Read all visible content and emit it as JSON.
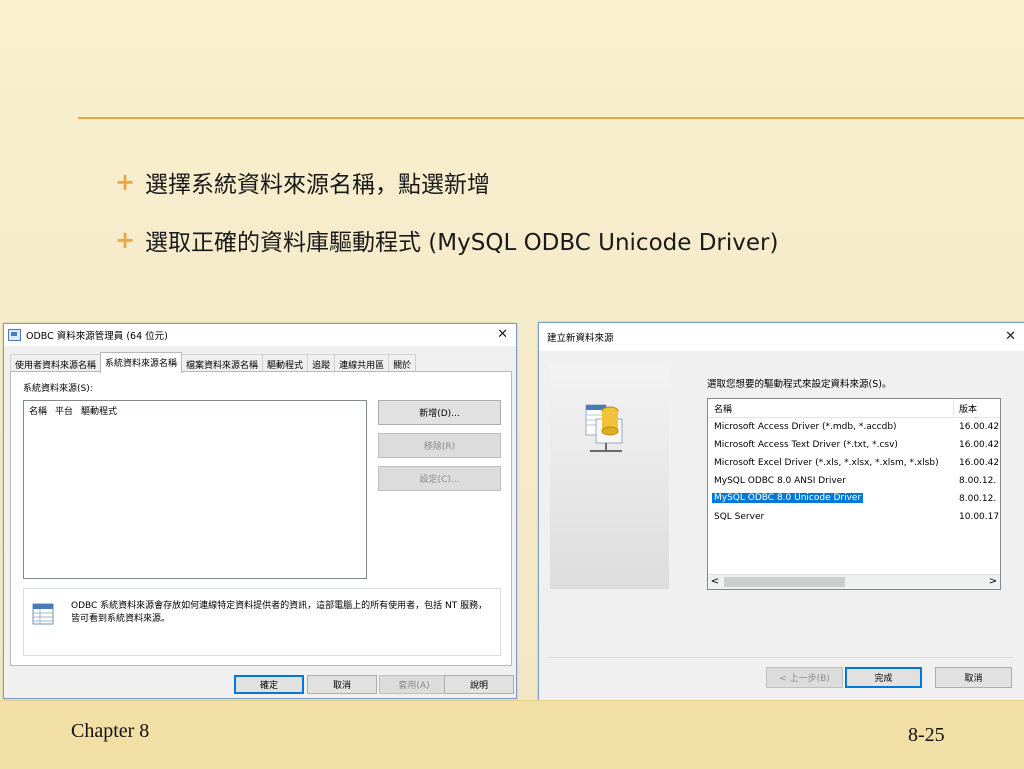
{
  "slide": {
    "bullets": [
      "選擇系統資料來源名稱，點選新增",
      "選取正確的資料庫驅動程式 (MySQL ODBC Unicode Driver)"
    ],
    "bullet_marker": "+",
    "footer_left": "Chapter 8",
    "footer_right": "8-25"
  },
  "odbc": {
    "title": "ODBC 資料來源管理員 (64 位元)",
    "close_glyph": "✕",
    "tabs": [
      "使用者資料來源名稱",
      "系統資料來源名稱",
      "檔案資料來源名稱",
      "驅動程式",
      "追蹤",
      "連線共用區",
      "關於"
    ],
    "active_tab_index": 1,
    "system_dsn_label": "系統資料來源(S):",
    "columns": [
      "名稱",
      "平台",
      "驅動程式"
    ],
    "buttons": {
      "add": "新增(D)...",
      "remove": "移除(R)",
      "configure": "設定(C)..."
    },
    "info_text": "ODBC 系統資料來源會存放如何連線特定資料提供者的資訊，這部電腦上的所有使用者，包括 NT 服務，皆可看到系統資料來源。",
    "bottom_buttons": {
      "ok": "確定",
      "cancel": "取消",
      "apply": "套用(A)",
      "help": "說明"
    }
  },
  "newds": {
    "title": "建立新資料來源",
    "close_glyph": "✕",
    "prompt": "選取您想要的驅動程式來設定資料來源(S)。",
    "columns": {
      "name": "名稱",
      "version": "版本"
    },
    "drivers": [
      {
        "name": "Microsoft Access Driver (*.mdb, *.accdb)",
        "version": "16.00.42"
      },
      {
        "name": "Microsoft Access Text Driver (*.txt, *.csv)",
        "version": "16.00.42"
      },
      {
        "name": "Microsoft Excel Driver (*.xls, *.xlsx, *.xlsm, *.xlsb)",
        "version": "16.00.42"
      },
      {
        "name": "MySQL ODBC 8.0 ANSI Driver",
        "version": "8.00.12."
      },
      {
        "name": "MySQL ODBC 8.0 Unicode Driver",
        "version": "8.00.12."
      },
      {
        "name": "SQL Server",
        "version": "10.00.17"
      }
    ],
    "selected_index": 4,
    "scroll_left": "<",
    "scroll_right": ">",
    "buttons": {
      "back": "< 上一步(B)",
      "finish": "完成",
      "cancel": "取消"
    }
  },
  "colors": {
    "accent": "#e8a64a",
    "selection": "#0078d7",
    "footer": "#f2dfa6"
  }
}
